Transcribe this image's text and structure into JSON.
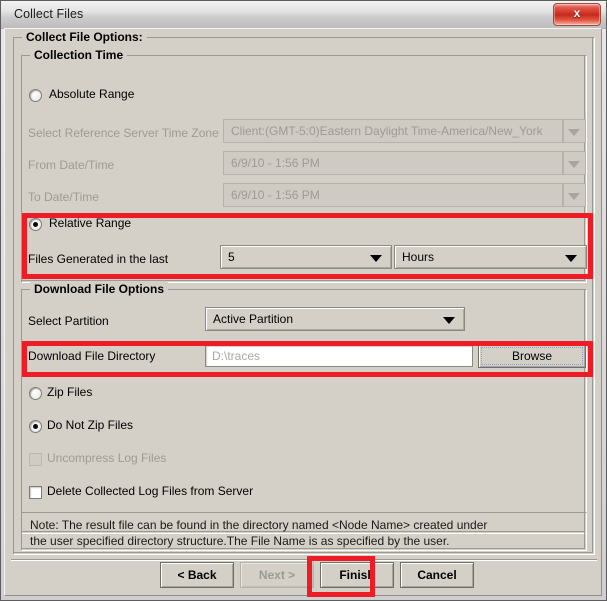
{
  "window": {
    "title": "Collect Files",
    "close_label": "x",
    "close_icon": "close-icon"
  },
  "groups": {
    "collect_file_options": "Collect File Options:",
    "collection_time": "Collection Time",
    "download_file_options": "Download File Options"
  },
  "collection_time": {
    "absolute_range": {
      "label": "Absolute Range",
      "selected": false,
      "enabled": true
    },
    "time_zone": {
      "label": "Select Reference Server Time Zone",
      "value": "Client:(GMT-5:0)Eastern Daylight Time-America/New_York",
      "enabled": false
    },
    "from_date": {
      "label": "From Date/Time",
      "value": "6/9/10 - 1:56 PM",
      "enabled": false
    },
    "to_date": {
      "label": "To Date/Time",
      "value": "6/9/10 - 1:56 PM",
      "enabled": false
    },
    "relative_range": {
      "label": "Relative Range",
      "selected": true,
      "enabled": true
    },
    "files_generated": {
      "label": "Files Generated in the last",
      "amount_value": "5",
      "unit_value": "Hours"
    }
  },
  "download_file_options": {
    "partition": {
      "label": "Select Partition",
      "value": "Active Partition"
    },
    "directory": {
      "label": "Download File Directory",
      "value": "D:\\traces",
      "browse_label": "Browse"
    },
    "zip_files": {
      "label": "Zip Files",
      "selected": false,
      "enabled": true
    },
    "do_not_zip_files": {
      "label": "Do Not Zip Files",
      "selected": true,
      "enabled": true
    },
    "uncompress_log_files": {
      "label": "Uncompress Log Files",
      "checked": false,
      "enabled": false
    },
    "delete_collected_log_files": {
      "label": "Delete Collected Log Files from Server",
      "checked": false,
      "enabled": true
    }
  },
  "note": {
    "line1": "Note: The result file can be found in the directory named <Node Name> created under",
    "line2": "the user specified directory structure.The File Name is as specified by the user."
  },
  "buttons": {
    "back": {
      "label": "< Back",
      "enabled": true
    },
    "next": {
      "label": "Next >",
      "enabled": false
    },
    "finish": {
      "label": "Finish",
      "enabled": true
    },
    "cancel": {
      "label": "Cancel",
      "enabled": true
    }
  },
  "annotations": {
    "highlight_color": "#ee1c25",
    "boxes": [
      "relative-range-highlight",
      "download-directory-highlight",
      "finish-button-highlight"
    ]
  }
}
